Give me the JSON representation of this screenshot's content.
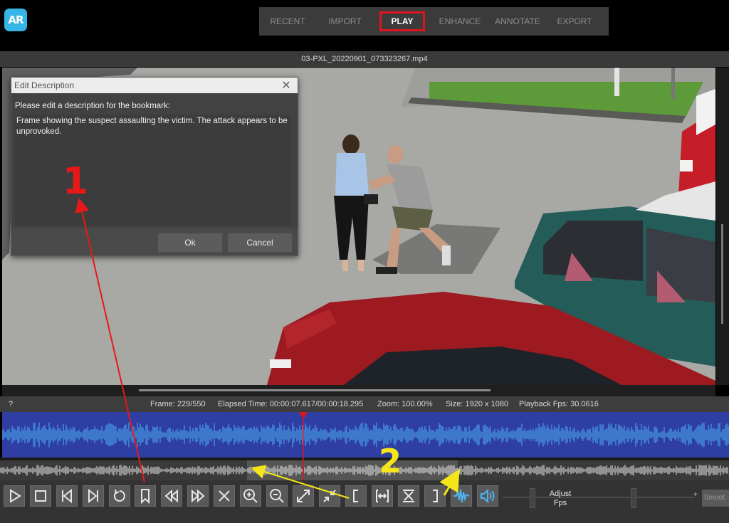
{
  "app": {
    "logo_text": "AR"
  },
  "nav": {
    "tabs": [
      {
        "label": "RECENT"
      },
      {
        "label": "IMPORT"
      },
      {
        "label": "PLAY"
      },
      {
        "label": "ENHANCE"
      },
      {
        "label": "ANNOTATE"
      },
      {
        "label": "EXPORT"
      }
    ],
    "active": "PLAY",
    "highlight_color": "#e0141e"
  },
  "file": {
    "name": "03-PXL_20220901_073323267.mp4"
  },
  "dialog": {
    "title": "Edit Description",
    "prompt": "Please edit a description for the bookmark:",
    "text": "Frame showing the suspect assaulting the victim. The attack appears to be unprovoked.",
    "ok_label": "Ok",
    "cancel_label": "Cancel"
  },
  "info": {
    "help": "?",
    "frame": "Frame: 229/550",
    "elapsed": "Elapsed Time: 00:00:07.617/00:00:18.295",
    "zoom": "Zoom: 100.00%",
    "size": "Size: 1920 x 1080",
    "fps": "Playback Fps: 30.0616"
  },
  "toolbar": {
    "adjust_fps_line1": "Adjust",
    "adjust_fps_line2": "Fps",
    "plus": "+",
    "smooth_label": "Smoot",
    "buttons": [
      "play-icon",
      "stop-icon",
      "step-back-icon",
      "step-forward-icon",
      "reload-icon",
      "bookmark-icon",
      "rewind-icon",
      "fast-forward-icon",
      "close-icon",
      "zoom-in-icon",
      "zoom-out-icon",
      "expand-icon",
      "collapse-icon",
      "bracket-open-icon",
      "fit-range-icon",
      "trim-icon",
      "bracket-close-icon",
      "waveform-icon",
      "volume-icon"
    ]
  },
  "annotations": {
    "label_1": "1",
    "label_2": "2",
    "color_1": "#e81818",
    "color_2": "#f5e619"
  },
  "colors": {
    "waveform_bg": "#2e3ea3",
    "waveform_fg": "#4fb3f0",
    "accent": "#35b6e6"
  }
}
